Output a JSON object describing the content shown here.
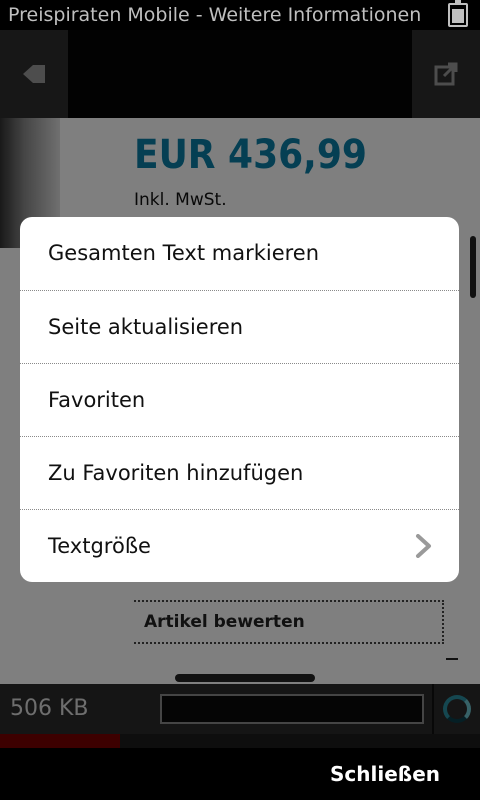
{
  "status_bar": {
    "title": "Preispiraten Mobile - Weitere Informationen",
    "battery_icon": "battery-icon"
  },
  "toolbar": {
    "back_icon": "back-arrow-icon",
    "external_icon": "open-external-icon"
  },
  "page": {
    "price": "EUR 436,99",
    "tax_note": "Inkl. MwSt.",
    "rate_article": "Artikel bewerten",
    "accent_color": "#0a7fa6"
  },
  "footer": {
    "page_size": "506 KB",
    "loading_icon": "loading-spinner-icon"
  },
  "context_menu": {
    "items": [
      {
        "label": "Gesamten Text markieren",
        "has_submenu": false
      },
      {
        "label": "Seite aktualisieren",
        "has_submenu": false
      },
      {
        "label": "Favoriten",
        "has_submenu": false
      },
      {
        "label": "Zu Favoriten hinzufügen",
        "has_submenu": false
      },
      {
        "label": "Textgröße",
        "has_submenu": true,
        "icon": "chevron-right-icon"
      }
    ]
  },
  "softkeys": {
    "close_label": "Schließen"
  }
}
